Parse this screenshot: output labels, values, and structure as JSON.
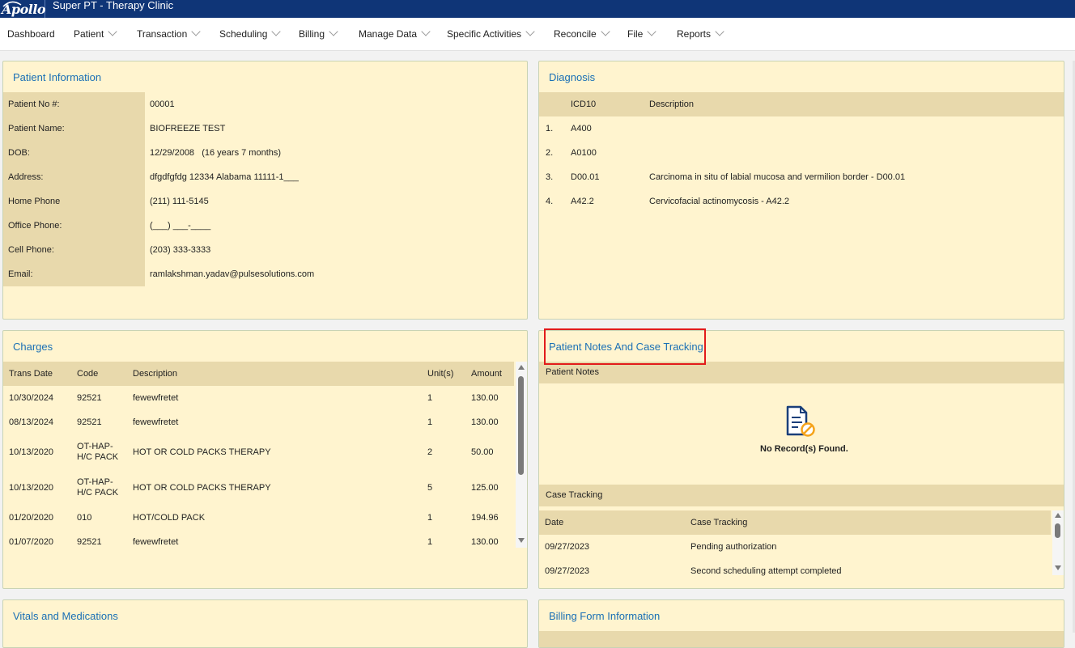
{
  "app": {
    "logo_text": "Apollo",
    "title": "Super PT - Therapy Clinic"
  },
  "menu": [
    {
      "label": "Dashboard",
      "has_dropdown": false
    },
    {
      "label": "Patient",
      "has_dropdown": true
    },
    {
      "label": "Transaction",
      "has_dropdown": true
    },
    {
      "label": "Scheduling",
      "has_dropdown": true
    },
    {
      "label": "Billing",
      "has_dropdown": true
    },
    {
      "label": "Manage Data",
      "has_dropdown": true
    },
    {
      "label": "Specific Activities",
      "has_dropdown": true
    },
    {
      "label": "Reconcile",
      "has_dropdown": true
    },
    {
      "label": "File",
      "has_dropdown": true
    },
    {
      "label": "Reports",
      "has_dropdown": true
    }
  ],
  "patient_info": {
    "title": "Patient Information",
    "rows": [
      {
        "label": "Patient No #:",
        "value": "00001"
      },
      {
        "label": "Patient Name:",
        "value": "BIOFREEZE TEST"
      },
      {
        "label": "DOB:",
        "value": "12/29/2008   (16 years 7 months)"
      },
      {
        "label": "Address:",
        "value": "dfgdfgfdg 12334 Alabama 11111-1___"
      },
      {
        "label": "Home Phone",
        "value": "(211) 111-5145"
      },
      {
        "label": "Office Phone:",
        "value": "(___) ___-____"
      },
      {
        "label": "Cell Phone:",
        "value": "(203) 333-3333"
      },
      {
        "label": "Email:",
        "value": "ramlakshman.yadav@pulsesolutions.com"
      }
    ]
  },
  "diagnosis": {
    "title": "Diagnosis",
    "columns": {
      "code": "ICD10",
      "description": "Description"
    },
    "rows": [
      {
        "num": "1.",
        "code": "A400",
        "description": ""
      },
      {
        "num": "2.",
        "code": "A0100",
        "description": ""
      },
      {
        "num": "3.",
        "code": "D00.01",
        "description": "Carcinoma in situ of labial mucosa and vermilion border - D00.01"
      },
      {
        "num": "4.",
        "code": "A42.2",
        "description": "Cervicofacial actinomycosis - A42.2"
      }
    ]
  },
  "charges": {
    "title": "Charges",
    "columns": {
      "date": "Trans Date",
      "code": "Code",
      "description": "Description",
      "units": "Unit(s)",
      "amount": "Amount"
    },
    "rows": [
      {
        "date": "10/30/2024",
        "code_l1": "92521",
        "code_l2": "",
        "description": "fewewfretet",
        "units": "1",
        "amount": "130.00"
      },
      {
        "date": "08/13/2024",
        "code_l1": "92521",
        "code_l2": "",
        "description": "fewewfretet",
        "units": "1",
        "amount": "130.00"
      },
      {
        "date": "10/13/2020",
        "code_l1": "OT-HAP-",
        "code_l2": "H/C PACK",
        "description": "HOT OR COLD PACKS THERAPY",
        "units": "2",
        "amount": "50.00"
      },
      {
        "date": "10/13/2020",
        "code_l1": "OT-HAP-",
        "code_l2": "H/C PACK",
        "description": "HOT OR COLD PACKS THERAPY",
        "units": "5",
        "amount": "125.00"
      },
      {
        "date": "01/20/2020",
        "code_l1": "010",
        "code_l2": "",
        "description": "HOT/COLD PACK",
        "units": "1",
        "amount": "194.96"
      },
      {
        "date": "01/07/2020",
        "code_l1": "92521",
        "code_l2": "",
        "description": "fewewfretet",
        "units": "1",
        "amount": "130.00"
      }
    ]
  },
  "notes": {
    "title": "Patient Notes And Case Tracking",
    "patient_notes_label": "Patient Notes",
    "no_records": "No Record(s) Found.",
    "case_tracking_label": "Case Tracking",
    "columns": {
      "date": "Date",
      "tracking": "Case Tracking"
    },
    "rows": [
      {
        "date": "09/27/2023",
        "tracking": "Pending authorization"
      },
      {
        "date": "09/27/2023",
        "tracking": "Second scheduling attempt completed"
      }
    ]
  },
  "vitals": {
    "title": "Vitals and Medications"
  },
  "billing_form": {
    "title": "Billing Form Information"
  },
  "colors": {
    "topbar": "#0f3577",
    "panel_bg": "#fff4cf",
    "header_bg": "#e8d9ac",
    "title_blue": "#1a6fb5",
    "highlight_red": "#e21b1b"
  }
}
